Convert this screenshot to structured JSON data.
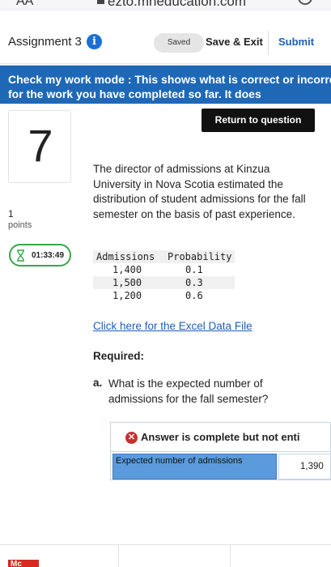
{
  "browser": {
    "aa_label": "AA",
    "url": "ezto.mheducation.com"
  },
  "header": {
    "title": "Assignment 3",
    "info_icon": "info-icon",
    "saved_label": "Saved",
    "save_exit_label": "Save & Exit",
    "submit_label": "Submit"
  },
  "banner": {
    "text": "Check my work mode : This shows what is correct or incorrect for the work you have completed so far. It does"
  },
  "question": {
    "number": "7",
    "points_value": "1",
    "points_label": "points",
    "timer": "01:33:49",
    "return_label": "Return to question",
    "text": "The director of admissions at Kinzua University in Nova Scotia estimated the distribution of student admissions for the fall semester on the basis of past experience.",
    "table": {
      "headers": [
        "Admissions",
        "Probability"
      ],
      "rows": [
        [
          "1,400",
          "0.1"
        ],
        [
          "1,500",
          "0.3"
        ],
        [
          "1,200",
          "0.6"
        ]
      ]
    },
    "excel_link": "Click here for the Excel Data File",
    "required_label": "Required:",
    "part_a_letter": "a.",
    "part_a_text": "What is the expected number of admissions for the fall semester?"
  },
  "answer": {
    "status": "Answer is complete but not enti",
    "status_icon": "x-circle-icon",
    "label": "Expected number of admissions",
    "value": "1,390"
  },
  "footer": {
    "logo_text": "Mc"
  },
  "colors": {
    "brand_blue": "#1f68b6",
    "link_blue": "#1d5fb5",
    "timer_green": "#3aa64a",
    "error_red": "#c9302c",
    "answer_label_bg": "#5b9bdc"
  }
}
